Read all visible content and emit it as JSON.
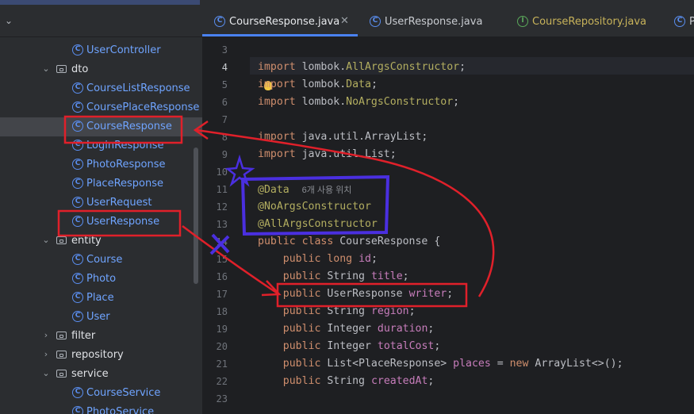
{
  "tree": {
    "items": [
      {
        "label": "UserController",
        "kind": "class",
        "indent": 1,
        "top": 0
      },
      {
        "label": "dto",
        "kind": "folder",
        "expanded": true
      },
      {
        "label": "CourseListResponse",
        "kind": "class"
      },
      {
        "label": "CoursePlaceResponse",
        "kind": "class"
      },
      {
        "label": "CourseResponse",
        "kind": "class",
        "selected": true
      },
      {
        "label": "LoginResponse",
        "kind": "class"
      },
      {
        "label": "PhotoResponse",
        "kind": "class"
      },
      {
        "label": "PlaceResponse",
        "kind": "class"
      },
      {
        "label": "UserRequest",
        "kind": "class"
      },
      {
        "label": "UserResponse",
        "kind": "class"
      },
      {
        "label": "entity",
        "kind": "folder",
        "expanded": true
      },
      {
        "label": "Course",
        "kind": "class"
      },
      {
        "label": "Photo",
        "kind": "class"
      },
      {
        "label": "Place",
        "kind": "class"
      },
      {
        "label": "User",
        "kind": "class"
      },
      {
        "label": "filter",
        "kind": "folder",
        "expanded": false
      },
      {
        "label": "repository",
        "kind": "folder",
        "expanded": false
      },
      {
        "label": "service",
        "kind": "folder",
        "expanded": true
      },
      {
        "label": "CourseService",
        "kind": "class"
      },
      {
        "label": "PhotoService",
        "kind": "class"
      }
    ]
  },
  "tabs": [
    {
      "label": "CourseResponse.java",
      "kind": "class",
      "active": true,
      "closable": true
    },
    {
      "label": "UserResponse.java",
      "kind": "class"
    },
    {
      "label": "CourseRepository.java",
      "kind": "interface"
    },
    {
      "label": "Pla",
      "kind": "class"
    }
  ],
  "editor": {
    "current_line": 4,
    "lines": [
      {
        "n": "3",
        "html": ""
      },
      {
        "n": "4",
        "html": "<span class='kw'>import</span> lombok.<span class='an'>AllArgsConstructor</span>;"
      },
      {
        "n": "5",
        "html": "<span class='kw'>import</span> lombok.<span class='an'>Data</span>;"
      },
      {
        "n": "6",
        "html": "<span class='kw'>import</span> lombok.<span class='an'>NoArgsConstructor</span>;"
      },
      {
        "n": "7",
        "html": ""
      },
      {
        "n": "8",
        "html": "<span class='kw'>import</span> java.util.ArrayList;"
      },
      {
        "n": "9",
        "html": "<span class='kw'>import</span> java.util.List;"
      },
      {
        "n": "10",
        "html": ""
      },
      {
        "n": "11",
        "html": "<span class='an'>@Data</span>  <span class='hint'>6개 사용 위치</span>"
      },
      {
        "n": "12",
        "html": "<span class='an'>@NoArgsConstructor</span>"
      },
      {
        "n": "13",
        "html": "<span class='an'>@AllArgsConstructor</span>"
      },
      {
        "n": "14",
        "html": "<span class='kw'>public class</span> CourseResponse {"
      },
      {
        "n": "15",
        "html": "    <span class='kw'>public long</span> <span class='fn'>id</span>;"
      },
      {
        "n": "16",
        "html": "    <span class='kw'>public</span> String <span class='fn'>title</span>;"
      },
      {
        "n": "17",
        "html": "    <span class='kw'>public</span> UserResponse <span class='fn'>writer</span>;"
      },
      {
        "n": "18",
        "html": "    <span class='kw'>public</span> String <span class='fn'>region</span>;"
      },
      {
        "n": "19",
        "html": "    <span class='kw'>public</span> Integer <span class='fn'>duration</span>;"
      },
      {
        "n": "20",
        "html": "    <span class='kw'>public</span> Integer <span class='fn'>totalCost</span>;"
      },
      {
        "n": "21",
        "html": "    <span class='kw'>public</span> List&lt;PlaceResponse&gt; <span class='fn'>places</span> = <span class='kw'>new</span> ArrayList&lt;&gt;();"
      },
      {
        "n": "22",
        "html": "    <span class='kw'>public</span> String <span class='fn'>createdAt</span>;"
      },
      {
        "n": "23",
        "html": ""
      }
    ]
  },
  "colors": {
    "red_annotation": "#e0202a",
    "blue_annotation": "#4a2fe0"
  }
}
